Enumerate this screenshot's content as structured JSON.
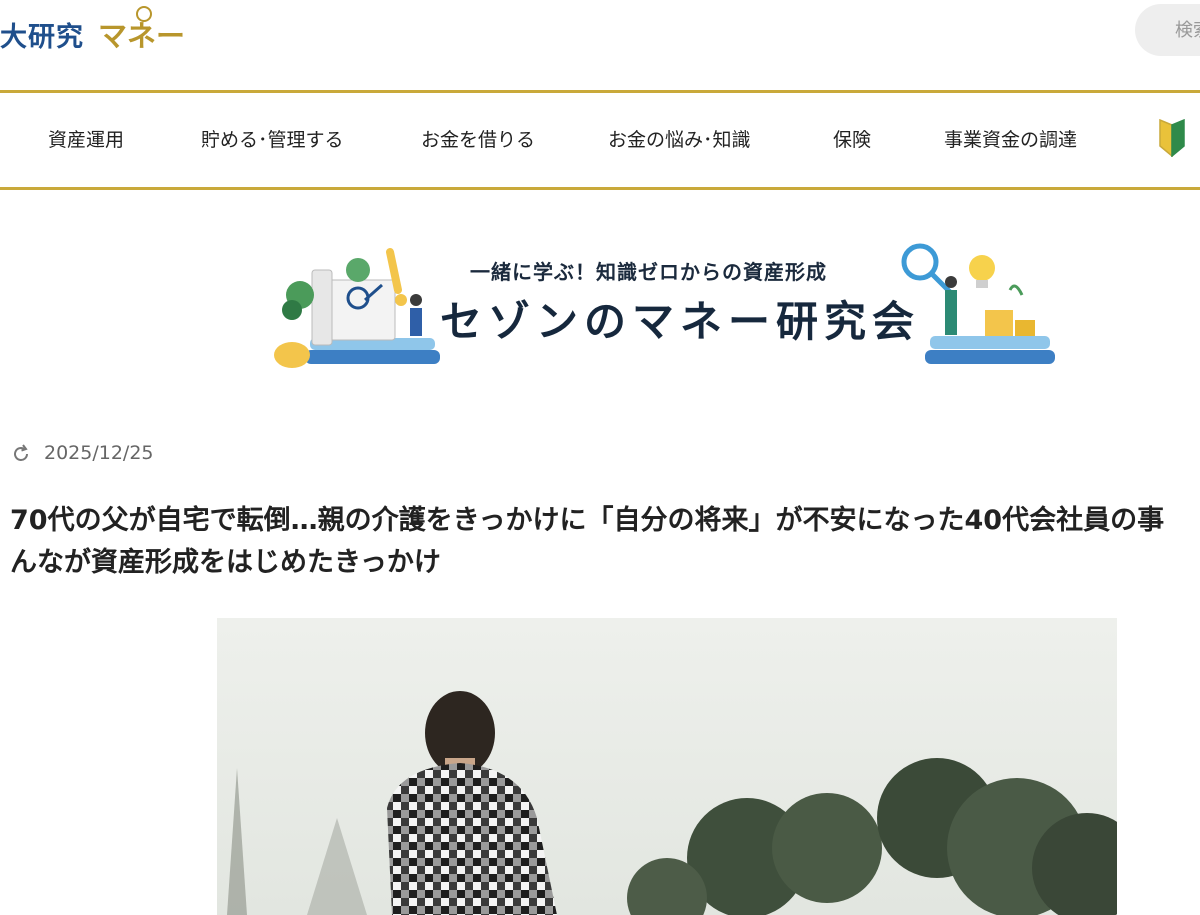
{
  "header": {
    "logo_main": "大研究",
    "logo_sub": "マネー",
    "search_placeholder": "検索"
  },
  "nav": {
    "items": [
      {
        "label": "資産運用"
      },
      {
        "label": "貯める･管理する"
      },
      {
        "label": "お金を借りる"
      },
      {
        "label": "お金の悩み･知識"
      },
      {
        "label": "保険"
      },
      {
        "label": "事業資金の調達"
      }
    ]
  },
  "banner": {
    "subtitle": "一緒に学ぶ！知識ゼロからの資産形成",
    "title": "セゾンのマネー研究会"
  },
  "article": {
    "date": "2025/12/25",
    "title_line1": "70代の父が自宅で転倒…親の介護をきっかけに「自分の将来」が不安になった40代会社員の事",
    "title_line2": "んなが資産形成をはじめたきっかけ"
  },
  "colors": {
    "brand_blue": "#1f4f8c",
    "brand_gold": "#c9a93a"
  }
}
